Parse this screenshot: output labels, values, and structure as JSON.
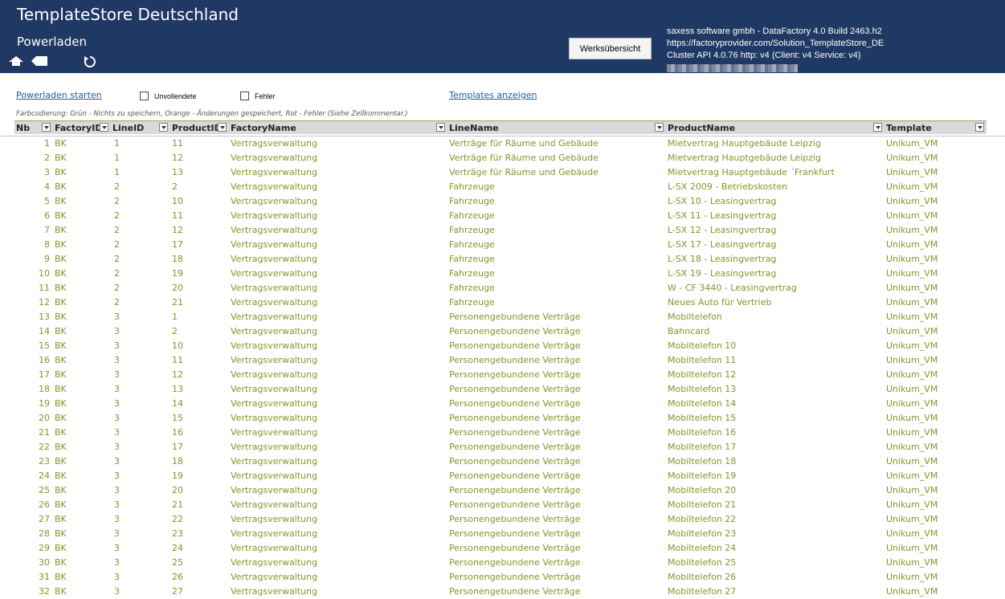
{
  "header": {
    "app_title": "TemplateStore Deutschland",
    "page_title": "Powerladen",
    "overview_button": "Werksübersicht",
    "info_line1": "saxess software gmbh - DataFactory 4.0 Build 2463.h2",
    "info_line2": "https://factoryprovider.com/Solution_TemplateStore_DE",
    "info_line3": "Cluster API 4.0.76 http: v4 (Client: v4 Service: v4)",
    "icons": [
      "home-icon",
      "back-icon",
      "refresh-icon"
    ]
  },
  "toolbar": {
    "start_link": "Powerladen starten",
    "unfinished_label": "Unvollendete",
    "error_label": "Fehler",
    "templates_link": "Templates anzeigen",
    "legend": "Farbcodierung: Grün - Nichts zu speichern, Orange - Änderungen gespeichert, Rot - Fehler (Siehe Zellkommentar.)"
  },
  "table": {
    "columns": [
      "Nb",
      "FactoryID",
      "LineID",
      "ProductID",
      "FactoryName",
      "LineName",
      "ProductName",
      "Template"
    ],
    "rows": [
      [
        "1",
        "BK",
        "1",
        "11",
        "Vertragsverwaltung",
        "Verträge für Räume und Gebäude",
        "Mietvertrag Hauptgebäude Leipzig",
        "Unikum_VM"
      ],
      [
        "2",
        "BK",
        "1",
        "12",
        "Vertragsverwaltung",
        "Verträge für Räume und Gebäude",
        "Mietvertrag Hauptgebäude Leipzig",
        "Unikum_VM"
      ],
      [
        "3",
        "BK",
        "1",
        "13",
        "Vertragsverwaltung",
        "Verträge für Räume und Gebäude",
        "Mietvertrag Hauptgebäude ´Frankfurt",
        "Unikum_VM"
      ],
      [
        "4",
        "BK",
        "2",
        "2",
        "Vertragsverwaltung",
        "Fahrzeuge",
        "L-SX 2009 - Betriebskosten",
        "Unikum_VM"
      ],
      [
        "5",
        "BK",
        "2",
        "10",
        "Vertragsverwaltung",
        "Fahrzeuge",
        "L-SX 10 - Leasingvertrag",
        "Unikum_VM"
      ],
      [
        "6",
        "BK",
        "2",
        "11",
        "Vertragsverwaltung",
        "Fahrzeuge",
        "L-SX 11 - Leasingvertrag",
        "Unikum_VM"
      ],
      [
        "7",
        "BK",
        "2",
        "12",
        "Vertragsverwaltung",
        "Fahrzeuge",
        "L-SX 12 - Leasingvertrag",
        "Unikum_VM"
      ],
      [
        "8",
        "BK",
        "2",
        "17",
        "Vertragsverwaltung",
        "Fahrzeuge",
        "L-SX 17 - Leasingvertrag",
        "Unikum_VM"
      ],
      [
        "9",
        "BK",
        "2",
        "18",
        "Vertragsverwaltung",
        "Fahrzeuge",
        "L-SX 18 - Leasingvertrag",
        "Unikum_VM"
      ],
      [
        "10",
        "BK",
        "2",
        "19",
        "Vertragsverwaltung",
        "Fahrzeuge",
        "L-SX 19 - Leasingvertrag",
        "Unikum_VM"
      ],
      [
        "11",
        "BK",
        "2",
        "20",
        "Vertragsverwaltung",
        "Fahrzeuge",
        "W - CF 3440 - Leasingvertrag",
        "Unikum_VM"
      ],
      [
        "12",
        "BK",
        "2",
        "21",
        "Vertragsverwaltung",
        "Fahrzeuge",
        "Neues Auto für Vertrieb",
        "Unikum_VM"
      ],
      [
        "13",
        "BK",
        "3",
        "1",
        "Vertragsverwaltung",
        "Personengebundene Verträge",
        "Mobiltelefon",
        "Unikum_VM"
      ],
      [
        "14",
        "BK",
        "3",
        "2",
        "Vertragsverwaltung",
        "Personengebundene Verträge",
        "Bahncard",
        "Unikum_VM"
      ],
      [
        "15",
        "BK",
        "3",
        "10",
        "Vertragsverwaltung",
        "Personengebundene Verträge",
        "Mobiltelefon 10",
        "Unikum_VM"
      ],
      [
        "16",
        "BK",
        "3",
        "11",
        "Vertragsverwaltung",
        "Personengebundene Verträge",
        "Mobiltelefon 11",
        "Unikum_VM"
      ],
      [
        "17",
        "BK",
        "3",
        "12",
        "Vertragsverwaltung",
        "Personengebundene Verträge",
        "Mobiltelefon 12",
        "Unikum_VM"
      ],
      [
        "18",
        "BK",
        "3",
        "13",
        "Vertragsverwaltung",
        "Personengebundene Verträge",
        "Mobiltelefon 13",
        "Unikum_VM"
      ],
      [
        "19",
        "BK",
        "3",
        "14",
        "Vertragsverwaltung",
        "Personengebundene Verträge",
        "Mobiltelefon 14",
        "Unikum_VM"
      ],
      [
        "20",
        "BK",
        "3",
        "15",
        "Vertragsverwaltung",
        "Personengebundene Verträge",
        "Mobiltelefon 15",
        "Unikum_VM"
      ],
      [
        "21",
        "BK",
        "3",
        "16",
        "Vertragsverwaltung",
        "Personengebundene Verträge",
        "Mobiltelefon 16",
        "Unikum_VM"
      ],
      [
        "22",
        "BK",
        "3",
        "17",
        "Vertragsverwaltung",
        "Personengebundene Verträge",
        "Mobiltelefon 17",
        "Unikum_VM"
      ],
      [
        "23",
        "BK",
        "3",
        "18",
        "Vertragsverwaltung",
        "Personengebundene Verträge",
        "Mobiltelefon 18",
        "Unikum_VM"
      ],
      [
        "24",
        "BK",
        "3",
        "19",
        "Vertragsverwaltung",
        "Personengebundene Verträge",
        "Mobiltelefon 19",
        "Unikum_VM"
      ],
      [
        "25",
        "BK",
        "3",
        "20",
        "Vertragsverwaltung",
        "Personengebundene Verträge",
        "Mobiltelefon 20",
        "Unikum_VM"
      ],
      [
        "26",
        "BK",
        "3",
        "21",
        "Vertragsverwaltung",
        "Personengebundene Verträge",
        "Mobiltelefon 21",
        "Unikum_VM"
      ],
      [
        "27",
        "BK",
        "3",
        "22",
        "Vertragsverwaltung",
        "Personengebundene Verträge",
        "Mobiltelefon 22",
        "Unikum_VM"
      ],
      [
        "28",
        "BK",
        "3",
        "23",
        "Vertragsverwaltung",
        "Personengebundene Verträge",
        "Mobiltelefon 23",
        "Unikum_VM"
      ],
      [
        "29",
        "BK",
        "3",
        "24",
        "Vertragsverwaltung",
        "Personengebundene Verträge",
        "Mobiltelefon 24",
        "Unikum_VM"
      ],
      [
        "30",
        "BK",
        "3",
        "25",
        "Vertragsverwaltung",
        "Personengebundene Verträge",
        "Mobiltelefon 25",
        "Unikum_VM"
      ],
      [
        "31",
        "BK",
        "3",
        "26",
        "Vertragsverwaltung",
        "Personengebundene Verträge",
        "Mobiltelefon 26",
        "Unikum_VM"
      ],
      [
        "32",
        "BK",
        "3",
        "27",
        "Vertragsverwaltung",
        "Personengebundene Verträge",
        "Mobiltelefon 27",
        "Unikum_VM"
      ]
    ]
  },
  "colors": {
    "header_bg": "#1f3864",
    "row_text_green": "#7c9a28",
    "link_blue": "#1f5aa6",
    "table_header_bg": "#d9d9d9"
  }
}
